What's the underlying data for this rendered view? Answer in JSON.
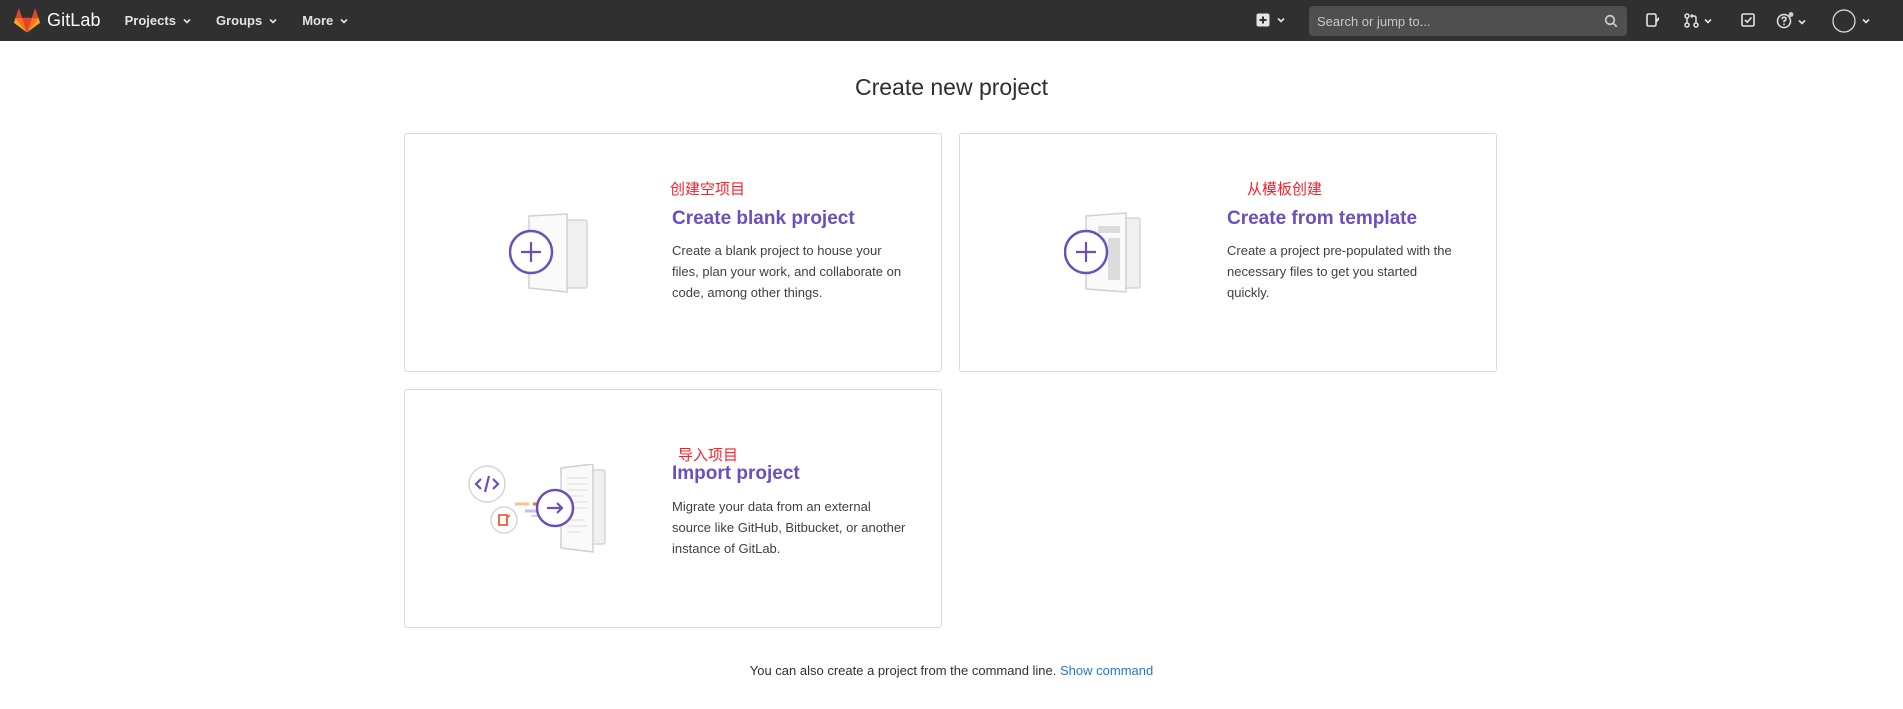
{
  "navbar": {
    "brand": "GitLab",
    "menu": [
      {
        "label": "Projects"
      },
      {
        "label": "Groups"
      },
      {
        "label": "More"
      }
    ],
    "search": {
      "placeholder": "Search or jump to..."
    },
    "icons": [
      "plus-square-icon",
      "issues-icon",
      "merge-request-icon",
      "todo-icon",
      "help-icon",
      "avatar"
    ]
  },
  "main": {
    "title": "Create new project",
    "cards": {
      "blank": {
        "annotation": "创建空项目",
        "title": "Create blank project",
        "description": "Create a blank project to house your files, plan your work, and collaborate on code, among other things."
      },
      "template": {
        "annotation": "从模板创建",
        "title": "Create from template",
        "description": "Create a project pre-populated with the necessary files to get you started quickly."
      },
      "import": {
        "annotation": "导入项目",
        "title": "Import project",
        "description": "Migrate your data from an external source like GitHub, Bitbucket, or another instance of GitLab."
      }
    },
    "footer": {
      "text": "You can also create a project from the command line.",
      "link": "Show command"
    }
  },
  "colors": {
    "navbar_bg": "#303030",
    "accent_purple": "#6b4fbb",
    "annotation_red": "#f5222d",
    "link_blue": "#1f78d1"
  }
}
